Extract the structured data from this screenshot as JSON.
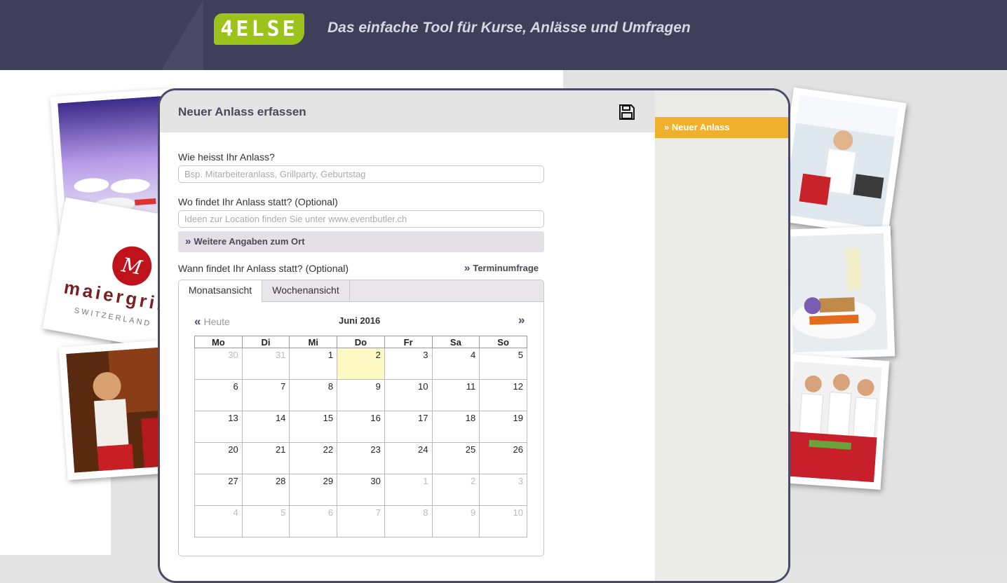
{
  "header": {
    "logo_text": "4ELSE",
    "tagline": "Das einfache Tool für Kurse, Anlässe und Umfragen",
    "brand_color": "#9bc31c",
    "bar_color": "#3f3f5b"
  },
  "photos": {
    "left": [
      "banquet-hall-photo",
      "maiergrill-logo-photo",
      "waitress-photo"
    ],
    "right": [
      "waitress-serving-photo",
      "plated-dish-photo",
      "service-staff-photo"
    ],
    "maiergrill_lettering": "maiergrill",
    "maiergrill_sub": "SWITZERLAND"
  },
  "card": {
    "title": "Neuer Anlass erfassen",
    "save_icon": "floppy-disk-icon"
  },
  "sidebar": {
    "items": [
      {
        "label": "» Neuer Anlass",
        "active": true,
        "color": "#efb02d"
      }
    ]
  },
  "form": {
    "name_label": "Wie heisst Ihr Anlass?",
    "name_placeholder": "Bsp. Mitarbeiteranlass, Grillparty, Geburtstag",
    "location_label": "Wo findet Ihr Anlass statt? (Optional)",
    "location_placeholder": "Ideen zur Location finden Sie unter www.eventbutler.ch",
    "more_location": "Weitere Angaben zum Ort",
    "date_label": "Wann findet Ihr Anlass statt? (Optional)",
    "poll_link": "Terminumfrage"
  },
  "calendar": {
    "tabs": [
      "Monatsansicht",
      "Wochenansicht"
    ],
    "active_tab": "Monatsansicht",
    "today_label": "Heute",
    "month": "Juni 2016",
    "weekdays": [
      "Mo",
      "Di",
      "Mi",
      "Do",
      "Fr",
      "Sa",
      "So"
    ],
    "weeks": [
      [
        {
          "d": "30",
          "o": true
        },
        {
          "d": "31",
          "o": true
        },
        {
          "d": "1"
        },
        {
          "d": "2",
          "today": true
        },
        {
          "d": "3"
        },
        {
          "d": "4"
        },
        {
          "d": "5"
        }
      ],
      [
        {
          "d": "6"
        },
        {
          "d": "7"
        },
        {
          "d": "8"
        },
        {
          "d": "9"
        },
        {
          "d": "10"
        },
        {
          "d": "11"
        },
        {
          "d": "12"
        }
      ],
      [
        {
          "d": "13"
        },
        {
          "d": "14"
        },
        {
          "d": "15"
        },
        {
          "d": "16"
        },
        {
          "d": "17"
        },
        {
          "d": "18"
        },
        {
          "d": "19"
        }
      ],
      [
        {
          "d": "20"
        },
        {
          "d": "21"
        },
        {
          "d": "22"
        },
        {
          "d": "23"
        },
        {
          "d": "24"
        },
        {
          "d": "25"
        },
        {
          "d": "26"
        }
      ],
      [
        {
          "d": "27"
        },
        {
          "d": "28"
        },
        {
          "d": "29"
        },
        {
          "d": "30"
        },
        {
          "d": "1",
          "o": true
        },
        {
          "d": "2",
          "o": true
        },
        {
          "d": "3",
          "o": true
        }
      ],
      [
        {
          "d": "4",
          "o": true
        },
        {
          "d": "5",
          "o": true
        },
        {
          "d": "6",
          "o": true
        },
        {
          "d": "7",
          "o": true
        },
        {
          "d": "8",
          "o": true
        },
        {
          "d": "9",
          "o": true
        },
        {
          "d": "10",
          "o": true
        }
      ]
    ]
  }
}
